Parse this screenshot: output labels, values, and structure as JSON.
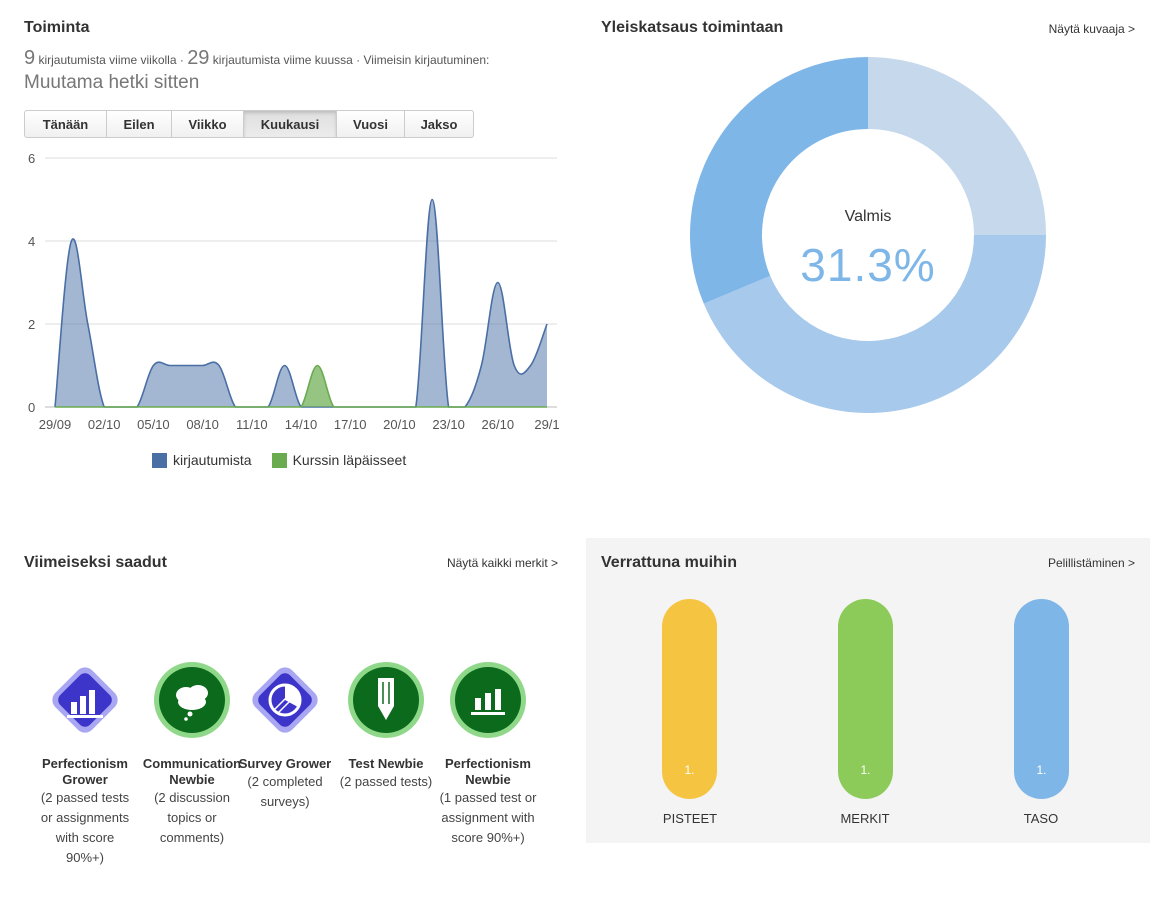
{
  "activity": {
    "title": "Toiminta",
    "week_count": "9",
    "week_text": "kirjautumista viime viikolla ·",
    "month_count": "29",
    "month_text": "kirjautumista viime kuussa · Viimeisin kirjautuminen:",
    "last_login": "Muutama hetki sitten",
    "tabs": [
      {
        "label": "Tänään"
      },
      {
        "label": "Eilen"
      },
      {
        "label": "Viikko"
      },
      {
        "label": "Kuukausi"
      },
      {
        "label": "Vuosi"
      },
      {
        "label": "Jakso"
      }
    ],
    "active_tab": "Kuukausi"
  },
  "chart_data": {
    "type": "area",
    "x": [
      "29/09",
      "30/09",
      "01/10",
      "02/10",
      "03/10",
      "04/10",
      "05/10",
      "06/10",
      "07/10",
      "08/10",
      "09/10",
      "10/10",
      "11/10",
      "12/10",
      "13/10",
      "14/10",
      "15/10",
      "16/10",
      "17/10",
      "18/10",
      "19/10",
      "20/10",
      "21/10",
      "22/10",
      "23/10",
      "24/10",
      "25/10",
      "26/10",
      "27/10",
      "28/10",
      "29/10"
    ],
    "tick_labels": [
      "29/09",
      "02/10",
      "05/10",
      "08/10",
      "11/10",
      "14/10",
      "17/10",
      "20/10",
      "23/10",
      "26/10",
      "29/1"
    ],
    "series": [
      {
        "name": "kirjautumista",
        "color": "#4a6fa5",
        "values": [
          0,
          4,
          2,
          0,
          0,
          0,
          1,
          1,
          1,
          1,
          1,
          0,
          0,
          0,
          1,
          0,
          0,
          0,
          0,
          0,
          0,
          0,
          0,
          5,
          0,
          0,
          1,
          3,
          1,
          1,
          2
        ]
      },
      {
        "name": "Kurssin läpäisseet",
        "color": "#6aab4f",
        "values": [
          0,
          0,
          0,
          0,
          0,
          0,
          0,
          0,
          0,
          0,
          0,
          0,
          0,
          0,
          0,
          0,
          1,
          0,
          0,
          0,
          0,
          0,
          0,
          0,
          0,
          0,
          0,
          0,
          0,
          0,
          0
        ]
      }
    ],
    "ylim": [
      0,
      6
    ],
    "yticks": [
      "0",
      "2",
      "4",
      "6"
    ],
    "grid": true,
    "legend": "bottom"
  },
  "overview": {
    "title": "Yleiskatsaus toimintaan",
    "link": "Näytä kuvaaja >",
    "label": "Valmis",
    "value": "31.3%",
    "segments": [
      {
        "value": 25,
        "color": "#c6d8ec"
      },
      {
        "value": 43.7,
        "color": "#a7c9ec"
      },
      {
        "value": 31.3,
        "color": "#7eb6e8"
      }
    ]
  },
  "badges": {
    "title": "Viimeiseksi saadut",
    "link": "Näytä kaikki merkit >",
    "items": [
      {
        "name": "Perfectionism Grower",
        "desc": "(2 passed tests or assignments with score 90%+)",
        "shape": "diamond",
        "icon": "bar-chart-icon"
      },
      {
        "name": "Communication Newbie",
        "desc": "(2 discussion topics or comments)",
        "shape": "circle",
        "icon": "speech-bubble-icon"
      },
      {
        "name": "Survey Grower",
        "desc": "(2 completed surveys)",
        "shape": "diamond",
        "icon": "pie-chart-icon"
      },
      {
        "name": "Test Newbie",
        "desc": "(2 passed tests)",
        "shape": "circle",
        "icon": "pencil-icon"
      },
      {
        "name": "Perfectionism Newbie",
        "desc": "(1 passed test or assignment with score 90%+)",
        "shape": "circle",
        "icon": "bar-chart-icon"
      }
    ]
  },
  "compare": {
    "title": "Verrattuna muihin",
    "link": "Pelillistäminen >",
    "bars": [
      {
        "label": "PISTEET",
        "rank": "1.",
        "color": "#f5c542"
      },
      {
        "label": "MERKIT",
        "rank": "1.",
        "color": "#8ccb5a"
      },
      {
        "label": "TASO",
        "rank": "1.",
        "color": "#7eb6e8"
      }
    ]
  }
}
